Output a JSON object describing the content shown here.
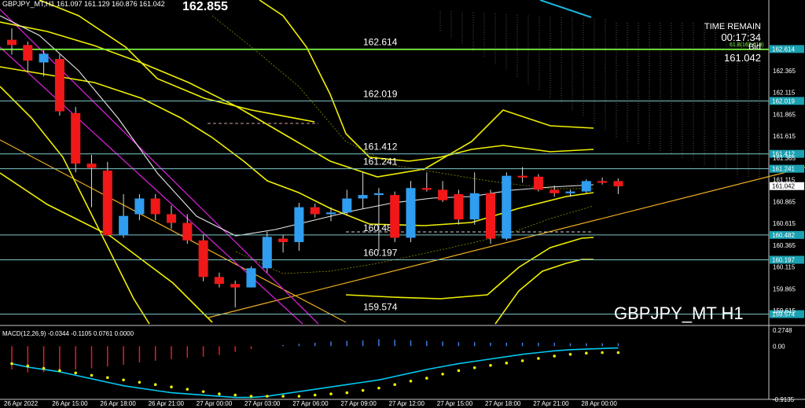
{
  "header": {
    "symbol_info": "GBPJPY_MT,H1  161.097 161.129 160.876 161.042",
    "big_price": "162.855"
  },
  "top_right": {
    "time_remain_label": "TIME REMAIN",
    "time_remain": "00:17:34",
    "bid_label": "Bid",
    "bid_value": "161.042"
  },
  "fib_label": "61.8(162.619)",
  "symbol_tf": "GBPJPY_MT H1",
  "macd_label": "MACD(12,26,9) -0.0344 -0.1105 0.0761 0.0000",
  "colors": {
    "background": "#000000",
    "bull_candle": "#2f9df0",
    "bear_candle": "#f01818",
    "level_line": "#7ec8c8",
    "fib_line": "#80ff40",
    "trend_line": "#f0b020",
    "channel_line": "#d020d0",
    "band_line": "#f0f000",
    "ma_line": "#ffffff",
    "macd_line": "#00c8f0",
    "macd_signal": "#f0f000"
  },
  "chart_data": {
    "type": "candlestick",
    "y_range": [
      159.48,
      163.05
    ],
    "price_axis_ticks": [
      "162.614",
      "162.365",
      "162.115",
      "162.019",
      "161.865",
      "161.615",
      "161.412",
      "161.365",
      "161.241",
      "161.115",
      "161.042",
      "160.865",
      "160.615",
      "160.482",
      "160.365",
      "160.197",
      "160.115",
      "159.865",
      "159.615",
      "159.574"
    ],
    "time_axis_labels": [
      "26 Apr 2022",
      "26 Apr 15:00",
      "26 Apr 18:00",
      "26 Apr 21:00",
      "27 Apr 00:00",
      "27 Apr 03:00",
      "27 Apr 06:00",
      "27 Apr 09:00",
      "27 Apr 12:00",
      "27 Apr 15:00",
      "27 Apr 18:00",
      "27 Apr 21:00",
      "28 Apr 00:00"
    ],
    "horizontal_levels": [
      {
        "value": 162.614,
        "label": "162.614"
      },
      {
        "value": 162.019,
        "label": "162.019"
      },
      {
        "value": 161.412,
        "label": "161.412"
      },
      {
        "value": 161.241,
        "label": "161.241"
      },
      {
        "value": 160.482,
        "label": "160.482"
      },
      {
        "value": 160.197,
        "label": "160.197"
      },
      {
        "value": 159.574,
        "label": "159.574"
      }
    ],
    "fib_level": {
      "value": 162.619,
      "label": "61.8(162.619)"
    },
    "current_price": 161.042,
    "candles": [
      {
        "o": 162.72,
        "h": 162.85,
        "l": 162.55,
        "c": 162.66
      },
      {
        "o": 162.66,
        "h": 162.7,
        "l": 162.35,
        "c": 162.48
      },
      {
        "o": 162.46,
        "h": 162.6,
        "l": 162.3,
        "c": 162.56
      },
      {
        "o": 162.5,
        "h": 162.55,
        "l": 161.85,
        "c": 161.9
      },
      {
        "o": 161.88,
        "h": 161.95,
        "l": 161.2,
        "c": 161.3
      },
      {
        "o": 161.3,
        "h": 161.4,
        "l": 160.8,
        "c": 161.25
      },
      {
        "o": 161.22,
        "h": 161.32,
        "l": 160.48,
        "c": 160.48
      },
      {
        "o": 160.48,
        "h": 160.95,
        "l": 160.45,
        "c": 160.7
      },
      {
        "o": 160.72,
        "h": 160.95,
        "l": 160.65,
        "c": 160.9
      },
      {
        "o": 160.9,
        "h": 160.95,
        "l": 160.65,
        "c": 160.72
      },
      {
        "o": 160.72,
        "h": 160.82,
        "l": 160.55,
        "c": 160.62
      },
      {
        "o": 160.62,
        "h": 160.72,
        "l": 160.38,
        "c": 160.42
      },
      {
        "o": 160.42,
        "h": 160.48,
        "l": 159.95,
        "c": 160.0
      },
      {
        "o": 160.0,
        "h": 160.05,
        "l": 159.88,
        "c": 159.92
      },
      {
        "o": 159.92,
        "h": 159.96,
        "l": 159.65,
        "c": 159.88
      },
      {
        "o": 159.88,
        "h": 160.12,
        "l": 159.88,
        "c": 160.1
      },
      {
        "o": 160.1,
        "h": 160.52,
        "l": 160.05,
        "c": 160.46
      },
      {
        "o": 160.44,
        "h": 160.48,
        "l": 160.28,
        "c": 160.4
      },
      {
        "o": 160.4,
        "h": 160.85,
        "l": 160.3,
        "c": 160.8
      },
      {
        "o": 160.8,
        "h": 160.84,
        "l": 160.68,
        "c": 160.72
      },
      {
        "o": 160.72,
        "h": 160.8,
        "l": 160.64,
        "c": 160.74
      },
      {
        "o": 160.74,
        "h": 161.0,
        "l": 160.7,
        "c": 160.9
      },
      {
        "o": 160.9,
        "h": 161.2,
        "l": 160.78,
        "c": 160.94
      },
      {
        "o": 160.94,
        "h": 161.02,
        "l": 160.3,
        "c": 160.96
      },
      {
        "o": 160.94,
        "h": 160.98,
        "l": 160.4,
        "c": 160.45
      },
      {
        "o": 160.45,
        "h": 161.1,
        "l": 160.4,
        "c": 161.02
      },
      {
        "o": 161.02,
        "h": 161.2,
        "l": 160.98,
        "c": 161.0
      },
      {
        "o": 161.0,
        "h": 161.1,
        "l": 160.86,
        "c": 160.88
      },
      {
        "o": 160.95,
        "h": 161.0,
        "l": 160.6,
        "c": 160.66
      },
      {
        "o": 160.66,
        "h": 161.2,
        "l": 160.6,
        "c": 160.96
      },
      {
        "o": 160.96,
        "h": 161.0,
        "l": 160.38,
        "c": 160.44
      },
      {
        "o": 160.44,
        "h": 161.2,
        "l": 160.42,
        "c": 161.16
      },
      {
        "o": 161.16,
        "h": 161.26,
        "l": 161.08,
        "c": 161.14
      },
      {
        "o": 161.15,
        "h": 161.18,
        "l": 160.98,
        "c": 161.0
      },
      {
        "o": 161.0,
        "h": 161.05,
        "l": 160.92,
        "c": 160.96
      },
      {
        "o": 160.96,
        "h": 161.0,
        "l": 160.92,
        "c": 160.98
      },
      {
        "o": 160.98,
        "h": 161.12,
        "l": 160.96,
        "c": 161.1
      },
      {
        "o": 161.1,
        "h": 161.14,
        "l": 161.06,
        "c": 161.08
      },
      {
        "o": 161.1,
        "h": 161.13,
        "l": 160.95,
        "c": 161.04
      }
    ],
    "macd": {
      "label": "MACD(12,26,9)",
      "y_range": [
        -0.9135,
        0.2748
      ],
      "ticks": [
        "0.2748",
        "0.00",
        "-0.9135"
      ],
      "histogram": [
        -0.4,
        -0.45,
        -0.45,
        -0.42,
        -0.4,
        -0.38,
        -0.35,
        -0.32,
        -0.28,
        -0.25,
        -0.22,
        -0.2,
        -0.18,
        -0.15,
        -0.1,
        -0.05,
        0.0,
        0.02,
        0.04,
        0.06,
        0.08,
        0.09,
        0.1,
        0.12,
        0.11,
        0.1,
        0.09,
        0.08,
        0.07,
        0.07,
        0.06,
        0.06,
        0.06,
        0.06,
        0.06,
        0.05,
        0.05,
        0.05,
        0.05
      ],
      "macd_line": [
        -0.3,
        -0.36,
        -0.4,
        -0.44,
        -0.5,
        -0.56,
        -0.62,
        -0.68,
        -0.72,
        -0.76,
        -0.8,
        -0.82,
        -0.84,
        -0.86,
        -0.88,
        -0.88,
        -0.86,
        -0.82,
        -0.78,
        -0.74,
        -0.7,
        -0.66,
        -0.62,
        -0.58,
        -0.52,
        -0.46,
        -0.4,
        -0.35,
        -0.3,
        -0.26,
        -0.22,
        -0.18,
        -0.14,
        -0.11,
        -0.08,
        -0.06,
        -0.05,
        -0.04,
        -0.03
      ],
      "signal": [
        -0.3,
        -0.34,
        -0.38,
        -0.42,
        -0.46,
        -0.5,
        -0.54,
        -0.58,
        -0.62,
        -0.66,
        -0.7,
        -0.74,
        -0.78,
        -0.82,
        -0.84,
        -0.86,
        -0.86,
        -0.86,
        -0.86,
        -0.84,
        -0.82,
        -0.8,
        -0.76,
        -0.72,
        -0.66,
        -0.6,
        -0.55,
        -0.48,
        -0.42,
        -0.37,
        -0.33,
        -0.29,
        -0.25,
        -0.21,
        -0.17,
        -0.14,
        -0.12,
        -0.11,
        -0.11
      ]
    }
  }
}
